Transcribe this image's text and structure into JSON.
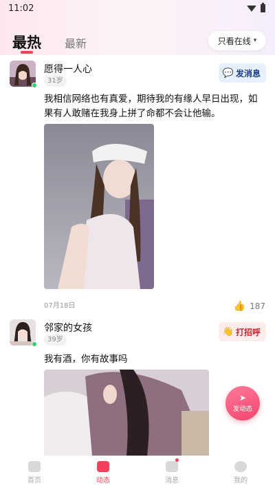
{
  "status_bar": {
    "time": "11:02",
    "icons": [
      "wifi-icon",
      "battery-icon"
    ]
  },
  "tabs": {
    "hot": "最热",
    "new": "最新",
    "filter": "只看在线"
  },
  "posts": [
    {
      "username": "愿得一人心",
      "age": "31岁",
      "action_label": "发消息",
      "action_icon": "chat-bubble-icon",
      "text": "我相信网络也有真爱，期待我的有缘人早日出现，如果有人敢赌在我身上拼了命都不会让他输。",
      "date": "07月18日",
      "likes": "187"
    },
    {
      "username": "邻家的女孩",
      "age": "39岁",
      "action_label": "打招呼",
      "action_icon": "wave-hand-icon",
      "text": "我有酒，你有故事吗"
    }
  ],
  "fab": {
    "label": "发动态",
    "icon": "send-icon"
  },
  "nav": [
    {
      "label": "首页",
      "icon": "home-icon"
    },
    {
      "label": "动态",
      "icon": "moments-icon"
    },
    {
      "label": "消息",
      "icon": "message-icon"
    },
    {
      "label": "我的",
      "icon": "profile-icon"
    }
  ],
  "colors": {
    "accent": "#f0425a",
    "online": "#2ecf6f",
    "msg_button_bg": "#e6f1ff",
    "greet_button_bg": "#ffecec"
  }
}
